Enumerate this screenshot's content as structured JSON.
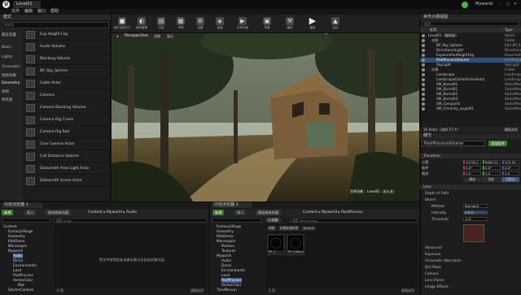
{
  "app": {
    "doc_tab": "Level01",
    "menu": [
      "文件",
      "编辑",
      "窗口",
      "帮助"
    ],
    "project": "Myworld"
  },
  "modes": {
    "tab_label": "模式",
    "search_placeholder": "搜索类",
    "categories": [
      "最近放置",
      "Basic",
      "Lights",
      "Cinematic",
      "视觉效果",
      "Geometry",
      "体积",
      "所有类"
    ],
    "selected_category": "Geometry",
    "items": [
      "Exp Height Fog",
      "Audio Volume",
      "Blocking Volume",
      "BP_Sky_Sphere",
      "Cable Actor",
      "Camera",
      "Camera Blocking Volume",
      "Camera Rig Crane",
      "Camera Rig Rail",
      "Cine Camera Actor",
      "Cull Distance Volume",
      "Datasmith Area Light Actor",
      "Datasmith Scene Actor"
    ]
  },
  "toolbar": {
    "buttons": [
      {
        "label": "保存当前关卡",
        "icon": "save-icon",
        "glyph": "■"
      },
      {
        "label": "源码管理",
        "icon": "source-control-icon",
        "glyph": "◐"
      },
      {
        "label": "内容",
        "icon": "content-icon",
        "glyph": "▤"
      },
      {
        "label": "市场",
        "icon": "marketplace-icon",
        "glyph": "▦"
      },
      {
        "label": "设置",
        "icon": "settings-icon",
        "glyph": "⚙"
      },
      {
        "label": "蓝图",
        "icon": "blueprint-icon",
        "glyph": "◈"
      },
      {
        "label": "过场动画",
        "icon": "cinematics-icon",
        "glyph": "▶"
      },
      {
        "label": "构建",
        "icon": "build-icon",
        "glyph": "▣"
      },
      {
        "label": "编译",
        "icon": "compile-icon",
        "glyph": "⚒"
      },
      {
        "label": "播放",
        "icon": "play-icon",
        "glyph": "▶"
      },
      {
        "label": "启动",
        "icon": "launch-icon",
        "glyph": "▲"
      }
    ]
  },
  "viewport": {
    "tab": "Perspective",
    "mode_buttons": [
      "光照",
      "显示"
    ],
    "level_label_prefix": "世界场景：",
    "level_name": "Level01",
    "level_suffix": "（永久关）"
  },
  "outliner": {
    "tab": "世界大纲视图",
    "search_placeholder": "搜索...",
    "col_label": "标签",
    "col_type": "Type",
    "rows": [
      {
        "name": "Level01（编辑器）",
        "type": "World",
        "indent": 0
      },
      {
        "name": "光照",
        "type": "Folder",
        "indent": 1
      },
      {
        "name": "BP_Sky_Sphere",
        "type": "Edit BP_S",
        "indent": 2
      },
      {
        "name": "DirectionalLight",
        "type": "Directiona",
        "indent": 2
      },
      {
        "name": "ExponentialHeightFog",
        "type": "Exponentia",
        "indent": 2
      },
      {
        "name": "PostProcessVolume",
        "type": "PostProces",
        "indent": 2,
        "selected": true
      },
      {
        "name": "SkyLight",
        "type": "SkyLight",
        "indent": 2
      },
      {
        "name": "风景",
        "type": "Folder",
        "indent": 1
      },
      {
        "name": "Landscape",
        "type": "Landscape",
        "indent": 2
      },
      {
        "name": "LandscapeGizmoActiveActor",
        "type": "Landscape",
        "indent": 2
      },
      {
        "name": "SM_Barrel01",
        "type": "StaticMesh",
        "indent": 2
      },
      {
        "name": "SM_Barrel01",
        "type": "StaticMesh",
        "indent": 2
      },
      {
        "name": "SM_Barrel02",
        "type": "StaticMesh",
        "indent": 2
      },
      {
        "name": "SM_Barrel03",
        "type": "StaticMesh",
        "indent": 2
      },
      {
        "name": "SM_Canopy01",
        "type": "StaticMesh",
        "indent": 2
      },
      {
        "name": "SM_Chimney_angel01",
        "type": "StaticMesh",
        "indent": 2
      }
    ],
    "footer": "35 Actor（选择了1个）",
    "view_options": "视图选项"
  },
  "details": {
    "tab": "细节",
    "actor_name": "PostProcessVolume",
    "add_component": "添加组件",
    "transform_header": "Transform",
    "transform_rows": [
      {
        "label": "位置",
        "values": [
          "10730.2",
          "6464.25",
          "225.94"
        ]
      },
      {
        "label": "旋转",
        "values": [
          "0.0°",
          "0.0°",
          "0.0°"
        ]
      },
      {
        "label": "缩放",
        "values": [
          "1.0",
          "1.0",
          "1.0"
        ]
      }
    ],
    "mobility": [
      "静态",
      "固定",
      "可移动"
    ],
    "sections": [
      "Lens",
      "Depth of Field",
      "Bloom",
      "Advanced",
      "Exposure",
      "Chromatic Aberration",
      "Dirt Mask",
      "Camera",
      "Lens Flares",
      "Image Effects"
    ],
    "bloom_rows": [
      {
        "label": "Method",
        "value": "Standard"
      },
      {
        "label": "Intensity",
        "value": "0.675"
      },
      {
        "label": "Threshold",
        "value": "-1.0"
      }
    ]
  },
  "cb_left": {
    "tab": "内容浏览器 1",
    "add_new": "新增",
    "import": "导入",
    "save_all": "保存所有内容",
    "path": [
      "Content",
      "Myworld",
      "Audio"
    ],
    "search_placeholder": "搜索 Audio",
    "empty_text": "把文件放到此处或者右键点击此处创建内容。",
    "status": "0 项",
    "view_options": "视图选项",
    "tree": [
      "Content",
      "FantasyVillage",
      "Geometry",
      "KiteDemo",
      "Mannequin",
      "Myworld",
      "Audio",
      "Decal",
      "Environments",
      "Land",
      "PostProcess",
      "VertexColor",
      "Mat",
      "StarterContent"
    ]
  },
  "cb_right": {
    "tab": "内容浏览器 2",
    "add_new": "新增",
    "import": "导入",
    "save_all": "保存所有内容",
    "path": [
      "Content",
      "Myworld",
      "PostProcess"
    ],
    "search_placeholder": "搜索 PostProcess",
    "filters": "过滤器",
    "filter_tags": [
      "材质",
      "后期处理材质",
      "Texture"
    ],
    "assets": [
      "PP_C...",
      "PP_Outline"
    ],
    "status": "2 项",
    "view_options": "视图选项",
    "tree": [
      "FantasyVillage",
      "Geometry",
      "KiteDemo",
      "Mannequin",
      "Meshes",
      "Textures",
      "Audio",
      "Mannequin",
      "Myworld",
      "Audio",
      "Decal",
      "Environments",
      "Land",
      "PostProcess",
      "VertexColor",
      "ThirdPerson",
      "ThirdPersonBP"
    ]
  }
}
